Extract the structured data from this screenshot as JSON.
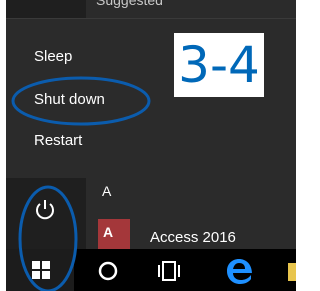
{
  "start_menu": {
    "suggested_label": "Suggested",
    "power_options": {
      "sleep": "Sleep",
      "shutdown": "Shut down",
      "restart": "Restart"
    },
    "apps_section_letter": "A",
    "app": {
      "tile_text": "A",
      "name": "Access 2016"
    }
  },
  "annotation": {
    "step_label": "3-4",
    "step_color": "#0068b8",
    "ellipse_color": "#0b5cad"
  },
  "taskbar": {
    "items": [
      "start-button",
      "cortana",
      "task-view",
      "edge",
      "file-explorer"
    ]
  }
}
